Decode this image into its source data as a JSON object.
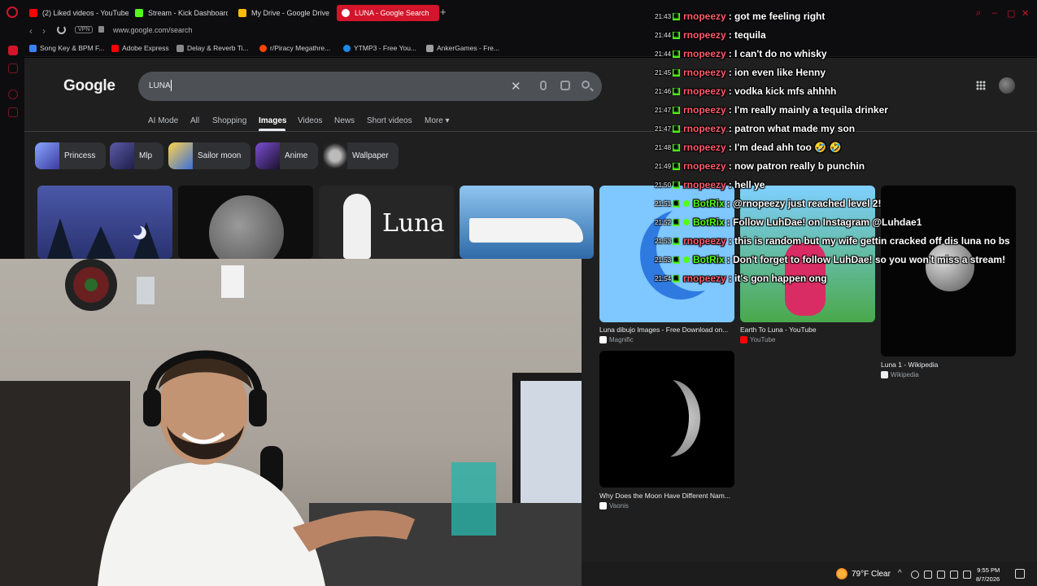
{
  "browser": {
    "tabs": [
      {
        "label": "(2) Liked videos - YouTube",
        "color": "#ff0000"
      },
      {
        "label": "Stream - Kick Dashboard",
        "color": "#53fc18"
      },
      {
        "label": "My Drive - Google Drive",
        "color": "#fbbc04"
      },
      {
        "label": "LUNA - Google Search",
        "color": "#ffffff"
      }
    ],
    "new_tab": "+",
    "url": "www.google.com/search",
    "vpn_label": "VPN",
    "bookmarks": [
      {
        "label": "Song Key & BPM F...",
        "color": "#3b82f6"
      },
      {
        "label": "Adobe Express",
        "color": "#ff0000"
      },
      {
        "label": "Delay & Reverb Ti...",
        "color": "#888888"
      },
      {
        "label": "r/Piracy Megathre...",
        "color": "#ff4500"
      },
      {
        "label": "YTMP3 - Free You...",
        "color": "#1e88e5"
      },
      {
        "label": "AnkerGames - Fre...",
        "color": "#9e9e9e"
      }
    ]
  },
  "google": {
    "logo": "Google",
    "query": "LUNA",
    "tabs": [
      "AI Mode",
      "All",
      "Shopping",
      "Images",
      "Videos",
      "News",
      "Short videos",
      "More ▾"
    ],
    "active_tab": "Images",
    "chips": [
      "Princess",
      "Mlp",
      "Sailor moon",
      "Anime",
      "Wallpaper"
    ],
    "luna_title_image_text": "Luna",
    "results": [
      {
        "caption": "Luna dibujo Images - Free Download on...",
        "source": "Magnific"
      },
      {
        "caption": "Earth To Luna - YouTube",
        "source": "YouTube"
      },
      {
        "caption": "Luna 1 - Wikipedia",
        "source": "Wikipedia"
      },
      {
        "caption": "Why Does the Moon Have Different Nam...",
        "source": "Vaonis"
      }
    ]
  },
  "chat": [
    {
      "time": "21:43",
      "user": "rnopeezy",
      "msg": ": got me feeling right",
      "user_color": "#ff5a6a"
    },
    {
      "time": "21:44",
      "user": "rnopeezy",
      "msg": ": tequila",
      "user_color": "#ff5a6a"
    },
    {
      "time": "21:44",
      "user": "rnopeezy",
      "msg": ": I can't do no whisky",
      "user_color": "#ff5a6a"
    },
    {
      "time": "21:45",
      "user": "rnopeezy",
      "msg": ": ion even like Henny",
      "user_color": "#ff5a6a"
    },
    {
      "time": "21:46",
      "user": "rnopeezy",
      "msg": ": vodka kick mfs ahhhh",
      "user_color": "#ff5a6a"
    },
    {
      "time": "21:47",
      "user": "rnopeezy",
      "msg": ": I'm really mainly a tequila drinker",
      "user_color": "#ff5a6a"
    },
    {
      "time": "21:47",
      "user": "rnopeezy",
      "msg": ": patron what made my son",
      "user_color": "#ff5a6a"
    },
    {
      "time": "21:48",
      "user": "rnopeezy",
      "msg": ": I'm dead ahh too 🤣 🤣",
      "user_color": "#ff5a6a"
    },
    {
      "time": "21:49",
      "user": "rnopeezy",
      "msg": ": now patron really b punchin",
      "user_color": "#ff5a6a"
    },
    {
      "time": "21:50",
      "user": "rnopeezy",
      "msg": ": hell ye",
      "user_color": "#ff5a6a"
    },
    {
      "time": "21:51",
      "user": "BotRix",
      "msg": ": @rnopeezy just reached level 2!",
      "user_color": "#53fc18"
    },
    {
      "time": "21:52",
      "user": "BotRix",
      "msg": ": Follow LuhDae! on Instagram @Luhdae1",
      "user_color": "#53fc18"
    },
    {
      "time": "21:53",
      "user": "rnopeezy",
      "msg": ": this is random but my wife gettin cracked off dis luna no bs",
      "user_color": "#ff5a6a"
    },
    {
      "time": "21:53",
      "user": "BotRix",
      "msg": ": Don't forget to follow LuhDae! so you won't miss a stream!",
      "user_color": "#53fc18"
    },
    {
      "time": "21:54",
      "user": "rnopeezy",
      "msg": ": it's gon happen ong",
      "user_color": "#ff5a6a"
    }
  ],
  "taskbar": {
    "weather": "79°F  Clear",
    "time": "9:55 PM",
    "date": "8/7/2026"
  },
  "colors": {
    "accent": "#d2152a",
    "kick_green": "#53fc18",
    "google_bg": "#1f1f1f"
  }
}
